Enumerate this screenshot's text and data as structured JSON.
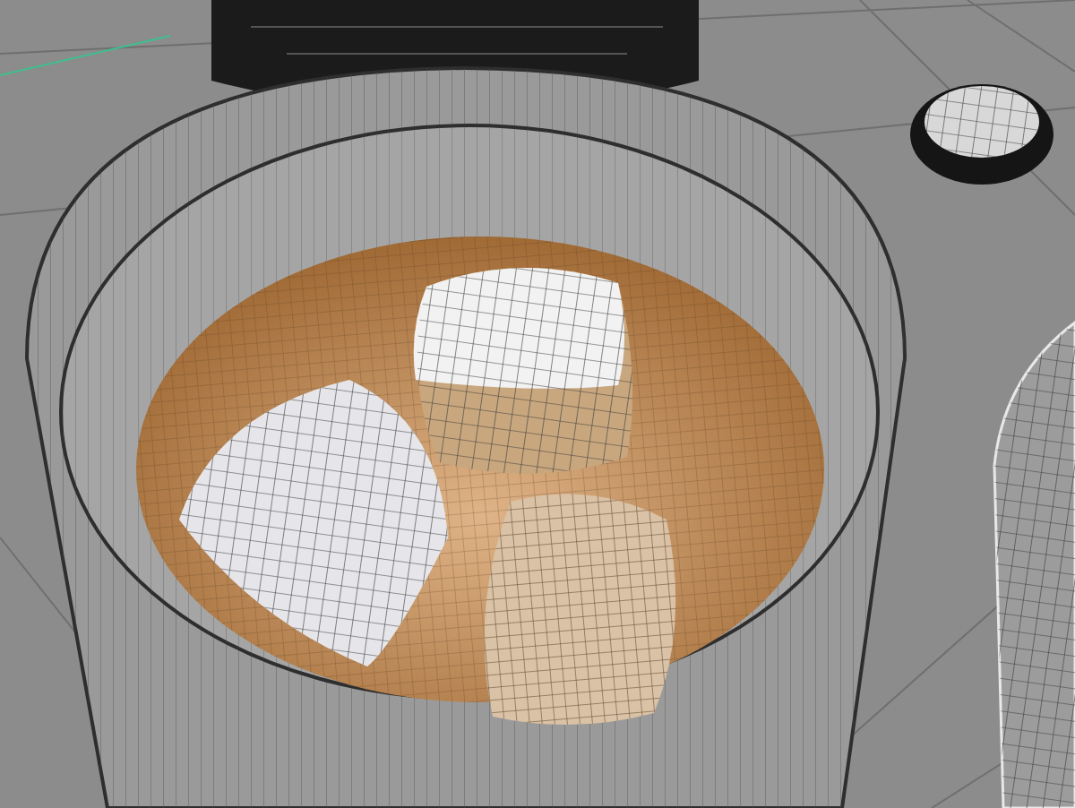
{
  "viewport": {
    "grid": true,
    "wireframe": true
  }
}
